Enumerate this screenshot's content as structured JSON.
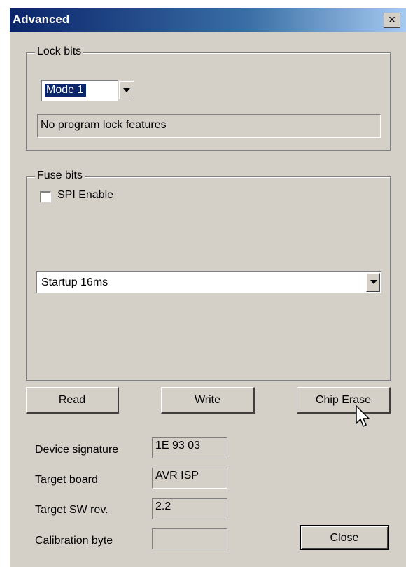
{
  "window": {
    "title": "Advanced",
    "close_glyph": "×"
  },
  "lock_bits": {
    "legend": "Lock bits",
    "mode_selected": "Mode 1",
    "description": "No program lock features"
  },
  "fuse_bits": {
    "legend": "Fuse bits",
    "spi_enable_label": "SPI Enable",
    "spi_enable_checked": false,
    "startup_selected": "Startup 16ms"
  },
  "buttons": {
    "read": "Read",
    "write": "Write",
    "chip_erase": "Chip Erase",
    "close": "Close"
  },
  "info": {
    "device_signature_label": "Device signature",
    "device_signature_value": "1E 93 03",
    "target_board_label": "Target board",
    "target_board_value": "AVR ISP",
    "target_sw_rev_label": "Target SW rev.",
    "target_sw_rev_value": "2.2",
    "calibration_byte_label": "Calibration byte",
    "calibration_byte_value": ""
  },
  "icons": {
    "dropdown": "chevron-down-icon",
    "cursor": "mouse-pointer-icon"
  }
}
